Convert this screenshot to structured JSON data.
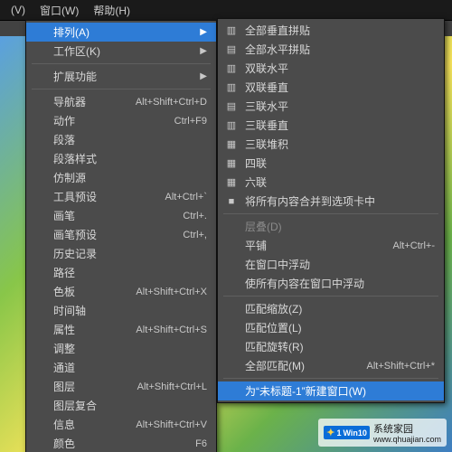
{
  "menubar": {
    "items": [
      "(V)",
      "窗口(W)",
      "帮助(H)"
    ]
  },
  "main_menu": [
    {
      "type": "item",
      "label": "排列(A)",
      "accel": "",
      "hl": true,
      "sub": true
    },
    {
      "type": "item",
      "label": "工作区(K)",
      "accel": "",
      "sub": true
    },
    {
      "type": "sep"
    },
    {
      "type": "item",
      "label": "扩展功能",
      "accel": "",
      "sub": true
    },
    {
      "type": "sep"
    },
    {
      "type": "item",
      "label": "导航器",
      "accel": "Alt+Shift+Ctrl+D"
    },
    {
      "type": "item",
      "label": "动作",
      "accel": "Ctrl+F9"
    },
    {
      "type": "item",
      "label": "段落",
      "accel": ""
    },
    {
      "type": "item",
      "label": "段落样式",
      "accel": ""
    },
    {
      "type": "item",
      "label": "仿制源",
      "accel": ""
    },
    {
      "type": "item",
      "label": "工具预设",
      "accel": "Alt+Ctrl+`"
    },
    {
      "type": "item",
      "label": "画笔",
      "accel": "Ctrl+."
    },
    {
      "type": "item",
      "label": "画笔预设",
      "accel": "Ctrl+,"
    },
    {
      "type": "item",
      "label": "历史记录",
      "accel": ""
    },
    {
      "type": "item",
      "label": "路径",
      "accel": ""
    },
    {
      "type": "item",
      "label": "色板",
      "accel": "Alt+Shift+Ctrl+X"
    },
    {
      "type": "item",
      "label": "时间轴",
      "accel": ""
    },
    {
      "type": "item",
      "label": "属性",
      "accel": "Alt+Shift+Ctrl+S"
    },
    {
      "type": "item",
      "label": "调整",
      "accel": ""
    },
    {
      "type": "item",
      "label": "通道",
      "accel": ""
    },
    {
      "type": "item",
      "label": "图层",
      "accel": "Alt+Shift+Ctrl+L"
    },
    {
      "type": "item",
      "label": "图层复合",
      "accel": ""
    },
    {
      "type": "item",
      "label": "信息",
      "accel": "Alt+Shift+Ctrl+V"
    },
    {
      "type": "item",
      "label": "颜色",
      "accel": "F6"
    }
  ],
  "sub_menu": [
    {
      "type": "item",
      "icon": "▥",
      "label": "全部垂直拼贴"
    },
    {
      "type": "item",
      "icon": "▤",
      "label": "全部水平拼贴"
    },
    {
      "type": "item",
      "icon": "▥",
      "label": "双联水平"
    },
    {
      "type": "item",
      "icon": "▥",
      "label": "双联垂直"
    },
    {
      "type": "item",
      "icon": "▤",
      "label": "三联水平"
    },
    {
      "type": "item",
      "icon": "▥",
      "label": "三联垂直"
    },
    {
      "type": "item",
      "icon": "▦",
      "label": "三联堆积"
    },
    {
      "type": "item",
      "icon": "▦",
      "label": "四联"
    },
    {
      "type": "item",
      "icon": "▦",
      "label": "六联"
    },
    {
      "type": "item",
      "icon": "■",
      "label": "将所有内容合并到选项卡中"
    },
    {
      "type": "sep"
    },
    {
      "type": "item",
      "label": "层叠(D)",
      "disabled": true
    },
    {
      "type": "item",
      "label": "平铺",
      "accel": "Alt+Ctrl+-"
    },
    {
      "type": "item",
      "label": "在窗口中浮动"
    },
    {
      "type": "item",
      "label": "使所有内容在窗口中浮动"
    },
    {
      "type": "sep"
    },
    {
      "type": "item",
      "label": "匹配缩放(Z)"
    },
    {
      "type": "item",
      "label": "匹配位置(L)"
    },
    {
      "type": "item",
      "label": "匹配旋转(R)"
    },
    {
      "type": "item",
      "label": "全部匹配(M)",
      "accel": "Alt+Shift+Ctrl+*"
    },
    {
      "type": "sep"
    },
    {
      "type": "item",
      "label": "为“未标题-1”新建窗口(W)",
      "hl": true
    }
  ],
  "watermark": {
    "badge_small": "1",
    "badge": "Win10",
    "text": "系统家园",
    "url": "www.qhuajian.com"
  }
}
